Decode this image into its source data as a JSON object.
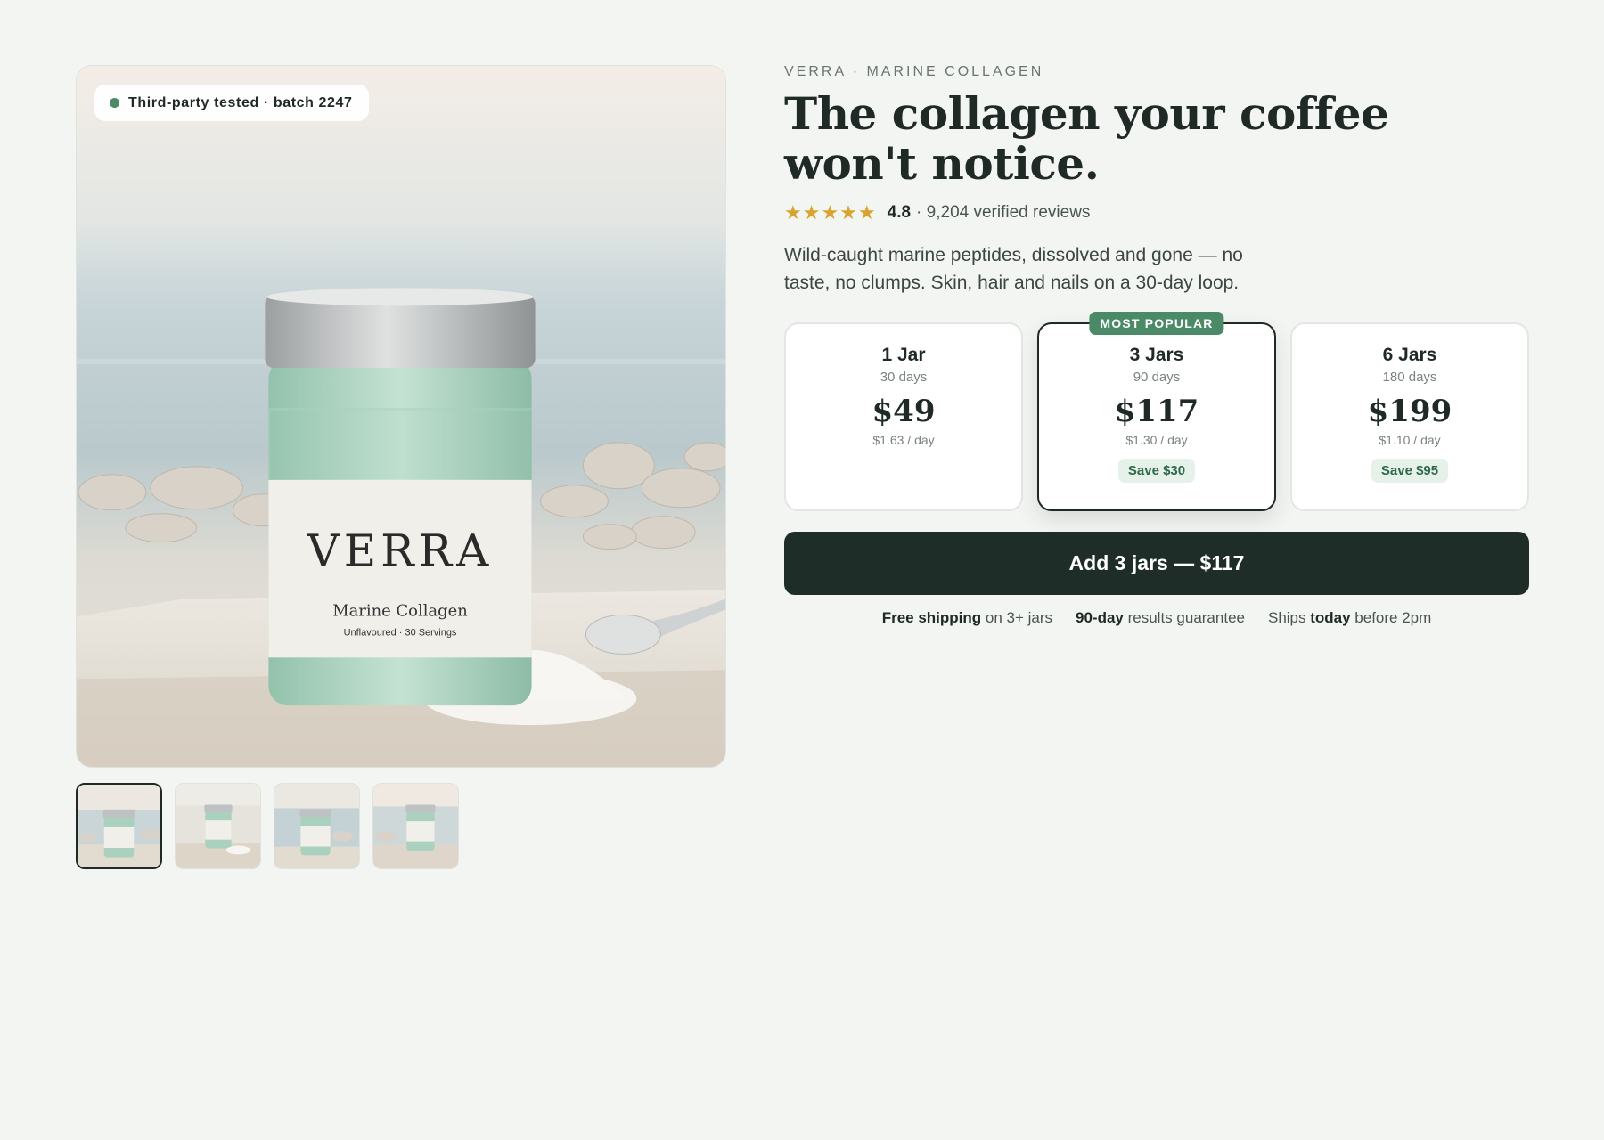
{
  "gallery": {
    "badge": "Third-party tested · batch 2247",
    "jar_brand": "VERRA",
    "jar_product": "Marine Collagen",
    "jar_variant": "Unflavoured · 30 Servings",
    "thumbnail_count": 4,
    "active_thumbnail": 1
  },
  "product": {
    "eyebrow": "VERRA · MARINE COLLAGEN",
    "title": "The collagen your coffee won't notice.",
    "stars": "★★★★★",
    "rating": "4.8",
    "reviews": "· 9,204 verified reviews",
    "description": "Wild-caught marine peptides, dissolved and gone — no taste, no clumps. Skin, hair and nails on a 30-day loop."
  },
  "plans": [
    {
      "name": "1 Jar",
      "days": "30 days",
      "price": "$49",
      "per_day": "$1.63 / day",
      "save": "",
      "tag": ""
    },
    {
      "name": "3 Jars",
      "days": "90 days",
      "price": "$117",
      "per_day": "$1.30 / day",
      "save": "Save $30",
      "tag": "MOST POPULAR"
    },
    {
      "name": "6 Jars",
      "days": "180 days",
      "price": "$199",
      "per_day": "$1.10 / day",
      "save": "Save $95",
      "tag": ""
    }
  ],
  "selected_plan": 2,
  "cta_label": "Add 3 jars — $117",
  "perks": [
    {
      "bold": "Free shipping",
      "rest": " on 3+ jars"
    },
    {
      "bold": "90-day",
      "rest": " results guarantee"
    },
    {
      "pre": "Ships ",
      "bold": "today",
      "rest": " before 2pm"
    }
  ],
  "colors": {
    "background": "#f3f5f2",
    "ink": "#1f2a26",
    "accent_green": "#4a8a66",
    "star_gold": "#d9a32f",
    "cta": "#1f2d28"
  }
}
